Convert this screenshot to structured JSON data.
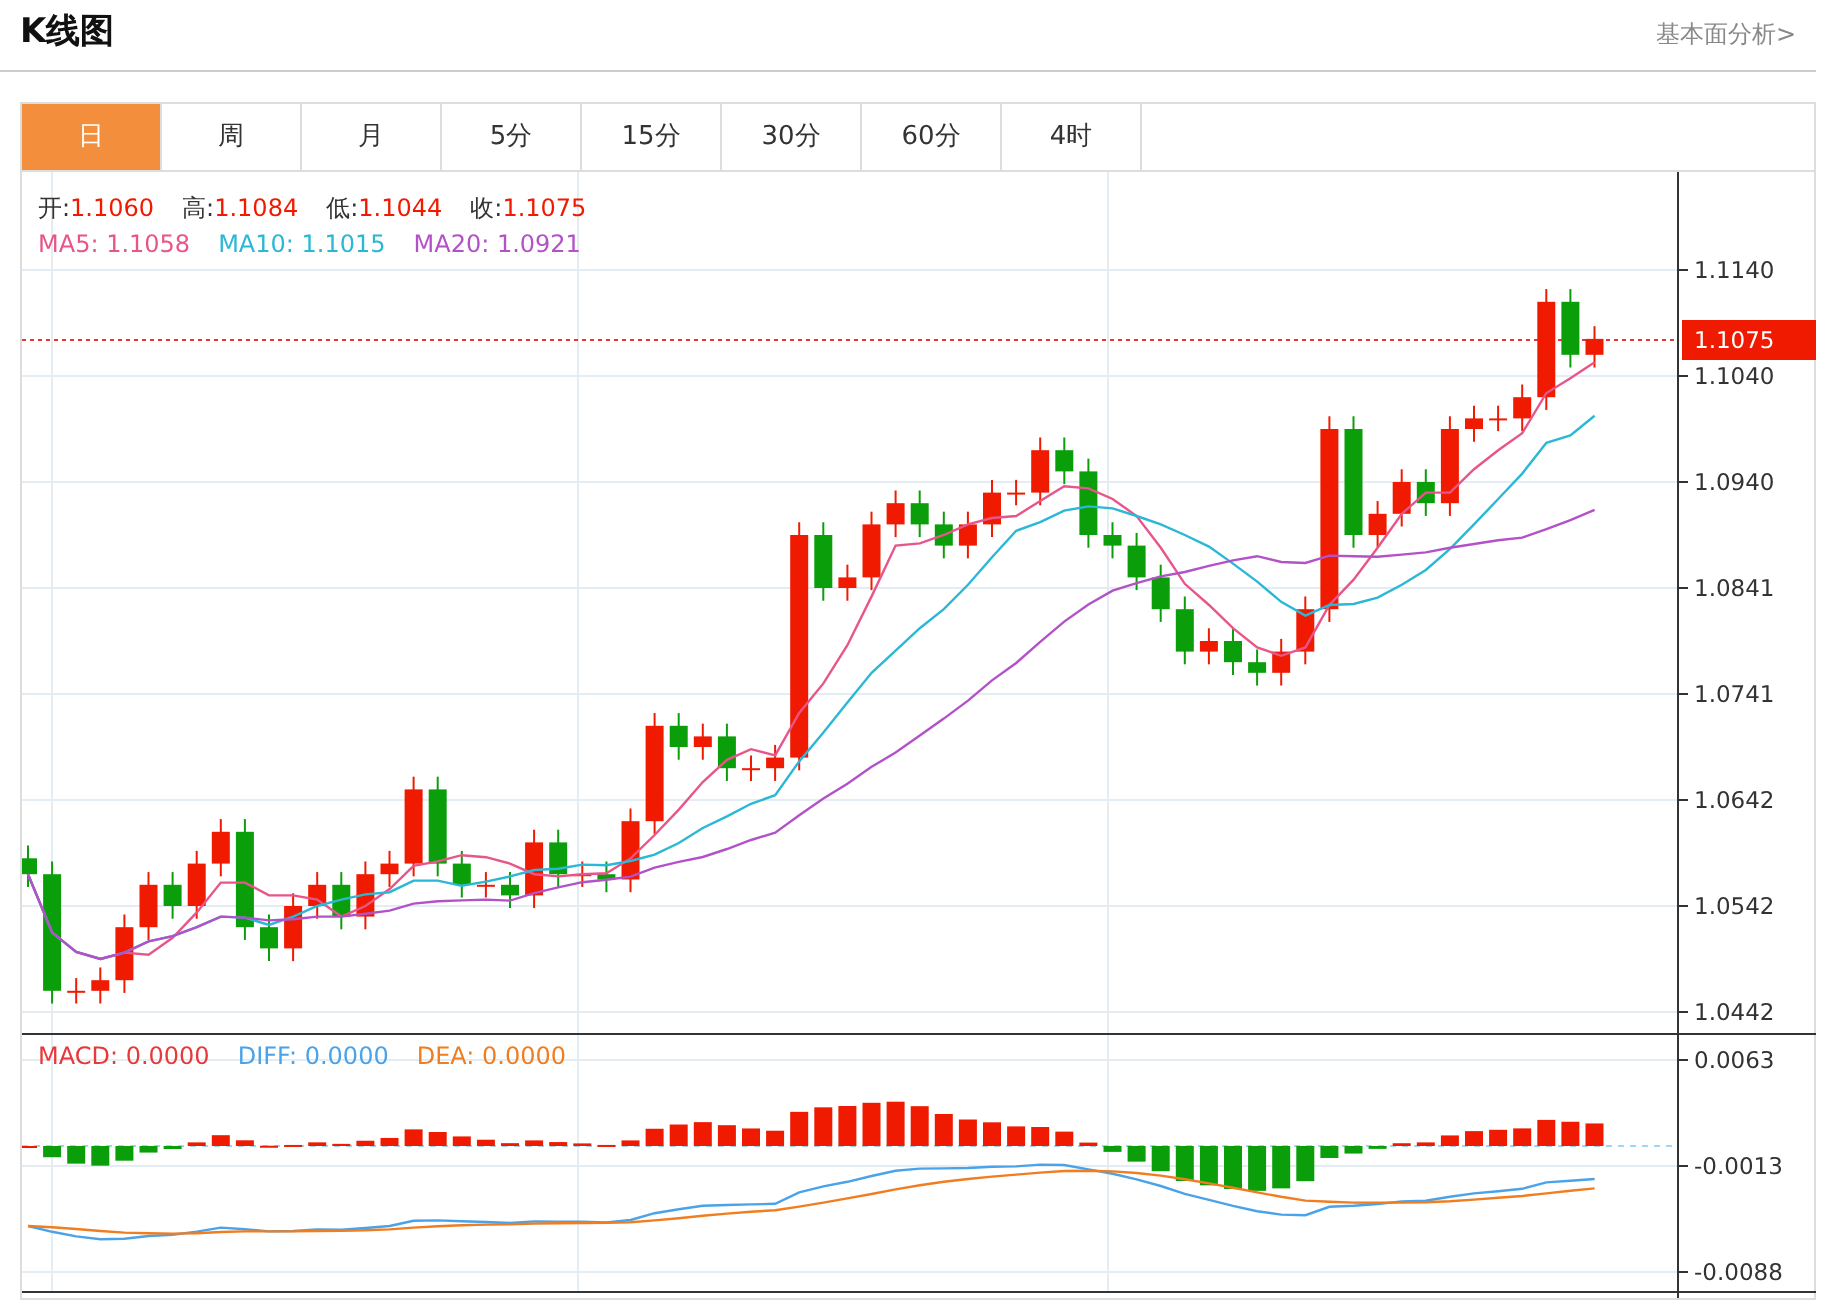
{
  "header": {
    "title": "K线图",
    "link": "基本面分析>"
  },
  "tabs": [
    {
      "label": "日",
      "selected": true
    },
    {
      "label": "周",
      "selected": false
    },
    {
      "label": "月",
      "selected": false
    },
    {
      "label": "5分",
      "selected": false
    },
    {
      "label": "15分",
      "selected": false
    },
    {
      "label": "30分",
      "selected": false
    },
    {
      "label": "60分",
      "selected": false
    },
    {
      "label": "4时",
      "selected": false
    }
  ],
  "price_legend": [
    {
      "label": "开:",
      "value": "1.1060"
    },
    {
      "label": "高:",
      "value": "1.1084"
    },
    {
      "label": "低:",
      "value": "1.1044"
    },
    {
      "label": "收:",
      "value": "1.1075"
    }
  ],
  "ma_legend": [
    {
      "label": "MA5:",
      "value": "1.1058",
      "color": "#e8558a"
    },
    {
      "label": "MA10:",
      "value": "1.1015",
      "color": "#2bb7d6"
    },
    {
      "label": "MA20:",
      "value": "1.0921",
      "color": "#b352c8"
    }
  ],
  "price_axis": {
    "ticks": [
      "1.1140",
      "1.1040",
      "1.0940",
      "1.0841",
      "1.0741",
      "1.0642",
      "1.0542",
      "1.0442"
    ],
    "current": "1.1075"
  },
  "macd_legend": [
    {
      "label": "MACD:",
      "value": "0.0000",
      "color": "#e8383a"
    },
    {
      "label": "DIFF:",
      "value": "0.0000",
      "color": "#4aa3e8"
    },
    {
      "label": "DEA:",
      "value": "0.0000",
      "color": "#f07d20"
    }
  ],
  "macd_axis": {
    "ticks": [
      "0.0063",
      "-0.0013",
      "-0.0088"
    ]
  }
}
